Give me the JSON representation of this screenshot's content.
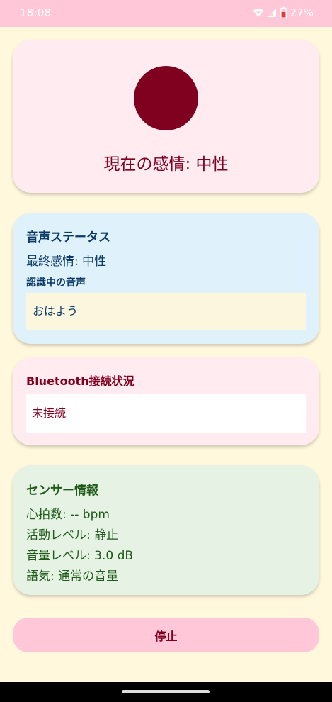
{
  "status_bar": {
    "time": "18:08",
    "battery": "27%",
    "icons": [
      "wifi-icon",
      "signal-icon",
      "battery-icon"
    ]
  },
  "emotion_card": {
    "circle_color": "#800020",
    "current_emotion": "現在の感情: 中性"
  },
  "voice_status": {
    "title": "音声ステータス",
    "last_emotion": "最終感情: 中性",
    "recognizing_label": "認識中の音声",
    "recognized_text": "おはよう"
  },
  "bluetooth": {
    "title": "Bluetooth接続状況",
    "status": "未接続"
  },
  "sensors": {
    "title": "センサー情報",
    "heart_rate": "心拍数: -- bpm",
    "activity": "活動レベル: 静止",
    "volume": "音量レベル: 3.0 dB",
    "tone": "語気: 通常の音量"
  },
  "controls": {
    "stop_label": "停止"
  },
  "colors": {
    "background": "#fff8dc",
    "accent": "#800020",
    "status_bar": "#ffc7d8",
    "voice_card": "#dff1fb",
    "sensor_card": "#e6f2e3"
  }
}
